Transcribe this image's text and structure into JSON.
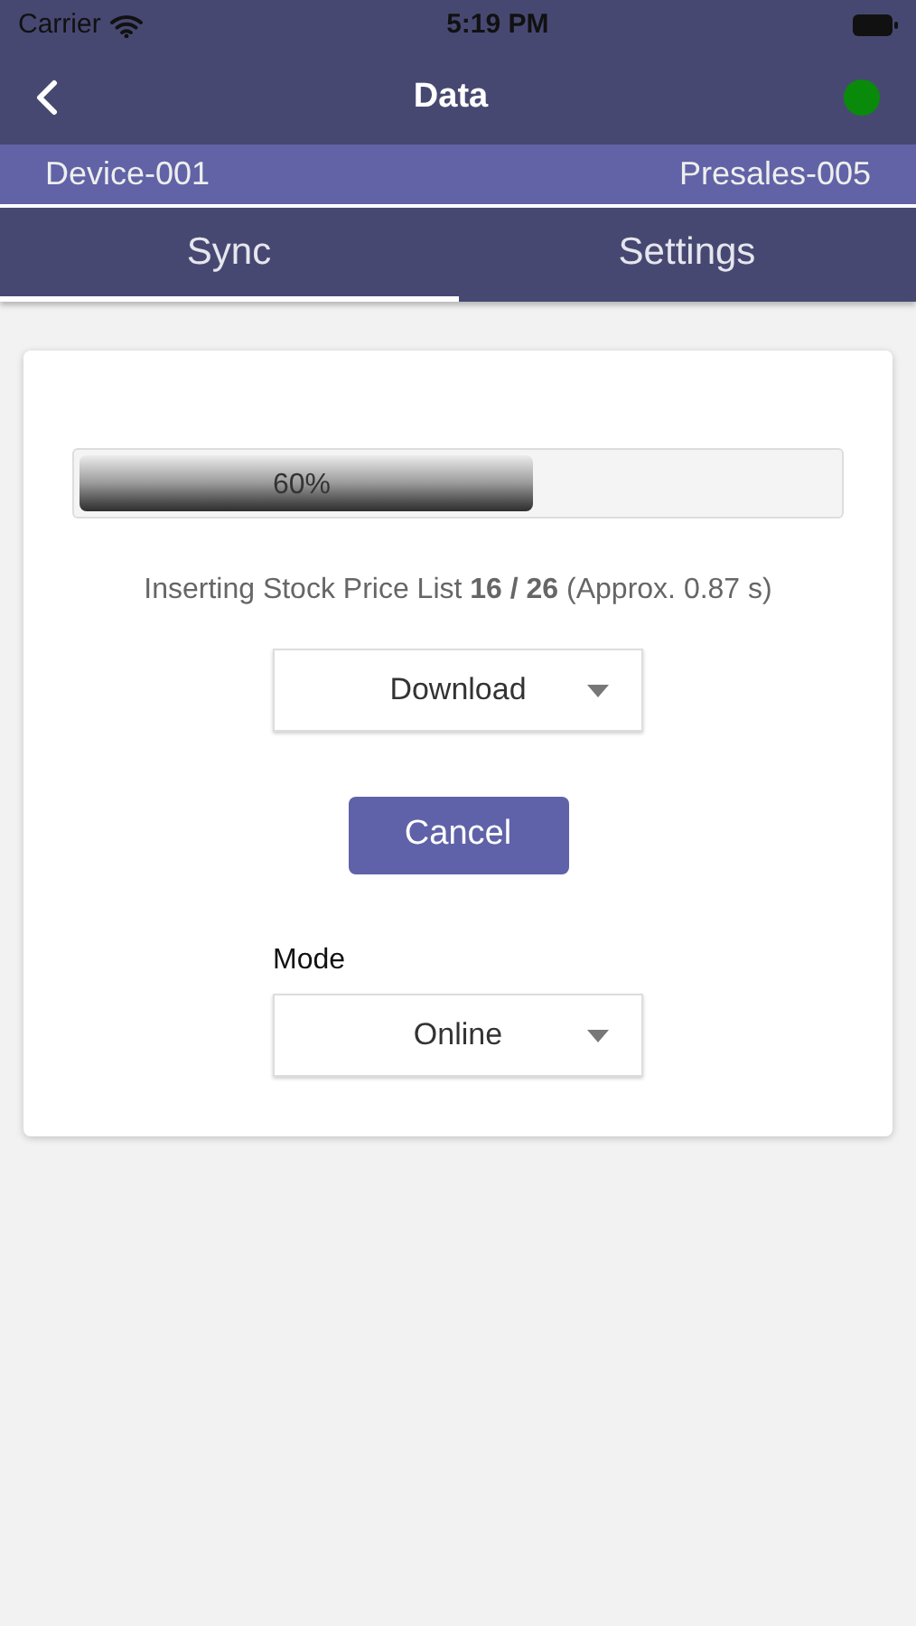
{
  "status_bar": {
    "carrier": "Carrier",
    "time": "5:19 PM"
  },
  "nav": {
    "title": "Data",
    "online": true
  },
  "info_bar": {
    "device": "Device-001",
    "presales": "Presales-005"
  },
  "tabs": [
    {
      "label": "Sync",
      "selected": true
    },
    {
      "label": "Settings",
      "selected": false
    }
  ],
  "progress": {
    "level": 0.6,
    "label": "60%"
  },
  "message": "Inserting Stock Price List **16 / 26** (Approx. 0.87 s)",
  "direction_select": {
    "value": "Download"
  },
  "cancel_button": "Cancel",
  "mode": {
    "label": "Mode",
    "value": "Online"
  }
}
